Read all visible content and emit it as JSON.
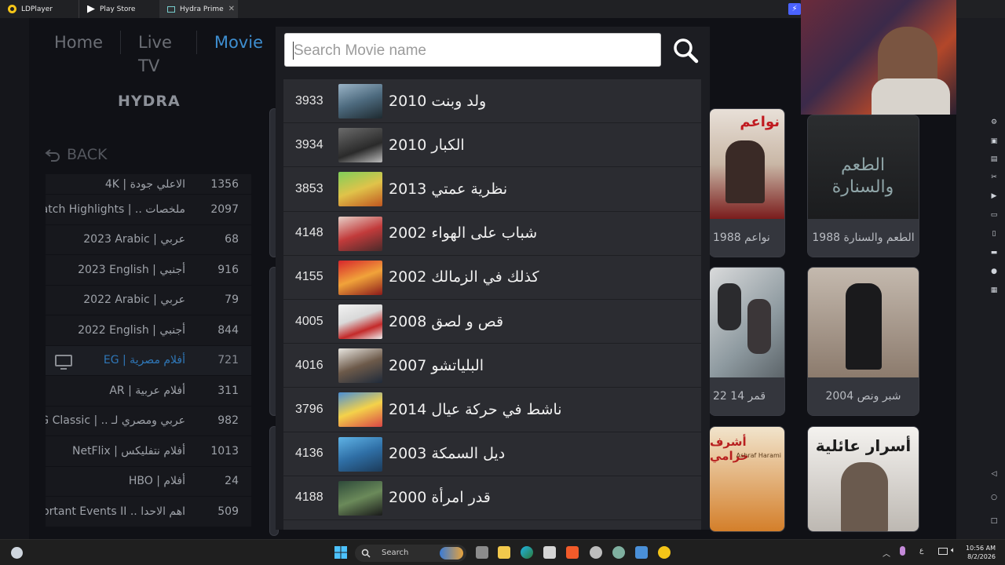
{
  "tabs": [
    {
      "label": "LDPlayer"
    },
    {
      "label": "Play Store"
    },
    {
      "label": "Hydra Prime"
    }
  ],
  "nav": {
    "home": "Home",
    "live_tv": "Live TV",
    "movies": "Movie"
  },
  "logo": "HYDRA",
  "back_label": "BACK",
  "categories": [
    {
      "label": "4K | الاعلي جودة",
      "count": "1356"
    },
    {
      "label": "Match Highlights | .. ملخصات",
      "count": "2097"
    },
    {
      "label": "2023 Arabic | عربي",
      "count": "68"
    },
    {
      "label": "2023 English | أجنبي",
      "count": "916"
    },
    {
      "label": "2022 Arabic | عربي",
      "count": "79"
    },
    {
      "label": "2022 English | أجنبي",
      "count": "844"
    },
    {
      "label": "EG | أفلام مصرية",
      "count": "721"
    },
    {
      "label": "AR | أفلام عربية",
      "count": "311"
    },
    {
      "label": "AR EG Classic | .. عربي ومصري لـ",
      "count": "982"
    },
    {
      "label": "NetFlix | أفلام نتفليكس",
      "count": "1013"
    },
    {
      "label": "HBO | أفلام",
      "count": "24"
    },
    {
      "label": "Important Events II .. اهم الاحدا",
      "count": "509"
    }
  ],
  "search": {
    "placeholder": "Search Movie name",
    "value": ""
  },
  "results": [
    {
      "num": "3933",
      "title": "ولد وبنت 2010"
    },
    {
      "num": "3934",
      "title": "الكبار 2010"
    },
    {
      "num": "3853",
      "title": "نظرية عمتي 2013"
    },
    {
      "num": "4148",
      "title": "شباب على الهواء 2002"
    },
    {
      "num": "4155",
      "title": "كذلك في الزمالك 2002"
    },
    {
      "num": "4005",
      "title": "قص و لصق 2008"
    },
    {
      "num": "4016",
      "title": "البلياتشو 2007"
    },
    {
      "num": "3796",
      "title": "ناشط في حركة عيال 2014"
    },
    {
      "num": "4136",
      "title": "ديل السمكة 2003"
    },
    {
      "num": "4188",
      "title": "قدر امرأة 2000"
    }
  ],
  "posters": [
    {
      "caption": "نواعم 1988"
    },
    {
      "caption": "الطعم والسنارة 1988"
    },
    {
      "caption": "قمر 14 22"
    },
    {
      "caption": "شبر ونص 2004"
    },
    {
      "caption": ""
    },
    {
      "caption": ""
    }
  ],
  "poster_texts": {
    "p1": "نواعم",
    "p2": "الطعم والسنارة",
    "p5": "أشرف حرامي",
    "p5b": "Ashraf Harami",
    "p6": "أسرار عائلية"
  },
  "taskbar": {
    "search": "Search",
    "time": "10:56 AM",
    "date": "8/2/2026",
    "lang": "ع"
  },
  "colors": {
    "accent": "#3e8ed0",
    "bg": "#101116",
    "row": "#2b2c31"
  }
}
